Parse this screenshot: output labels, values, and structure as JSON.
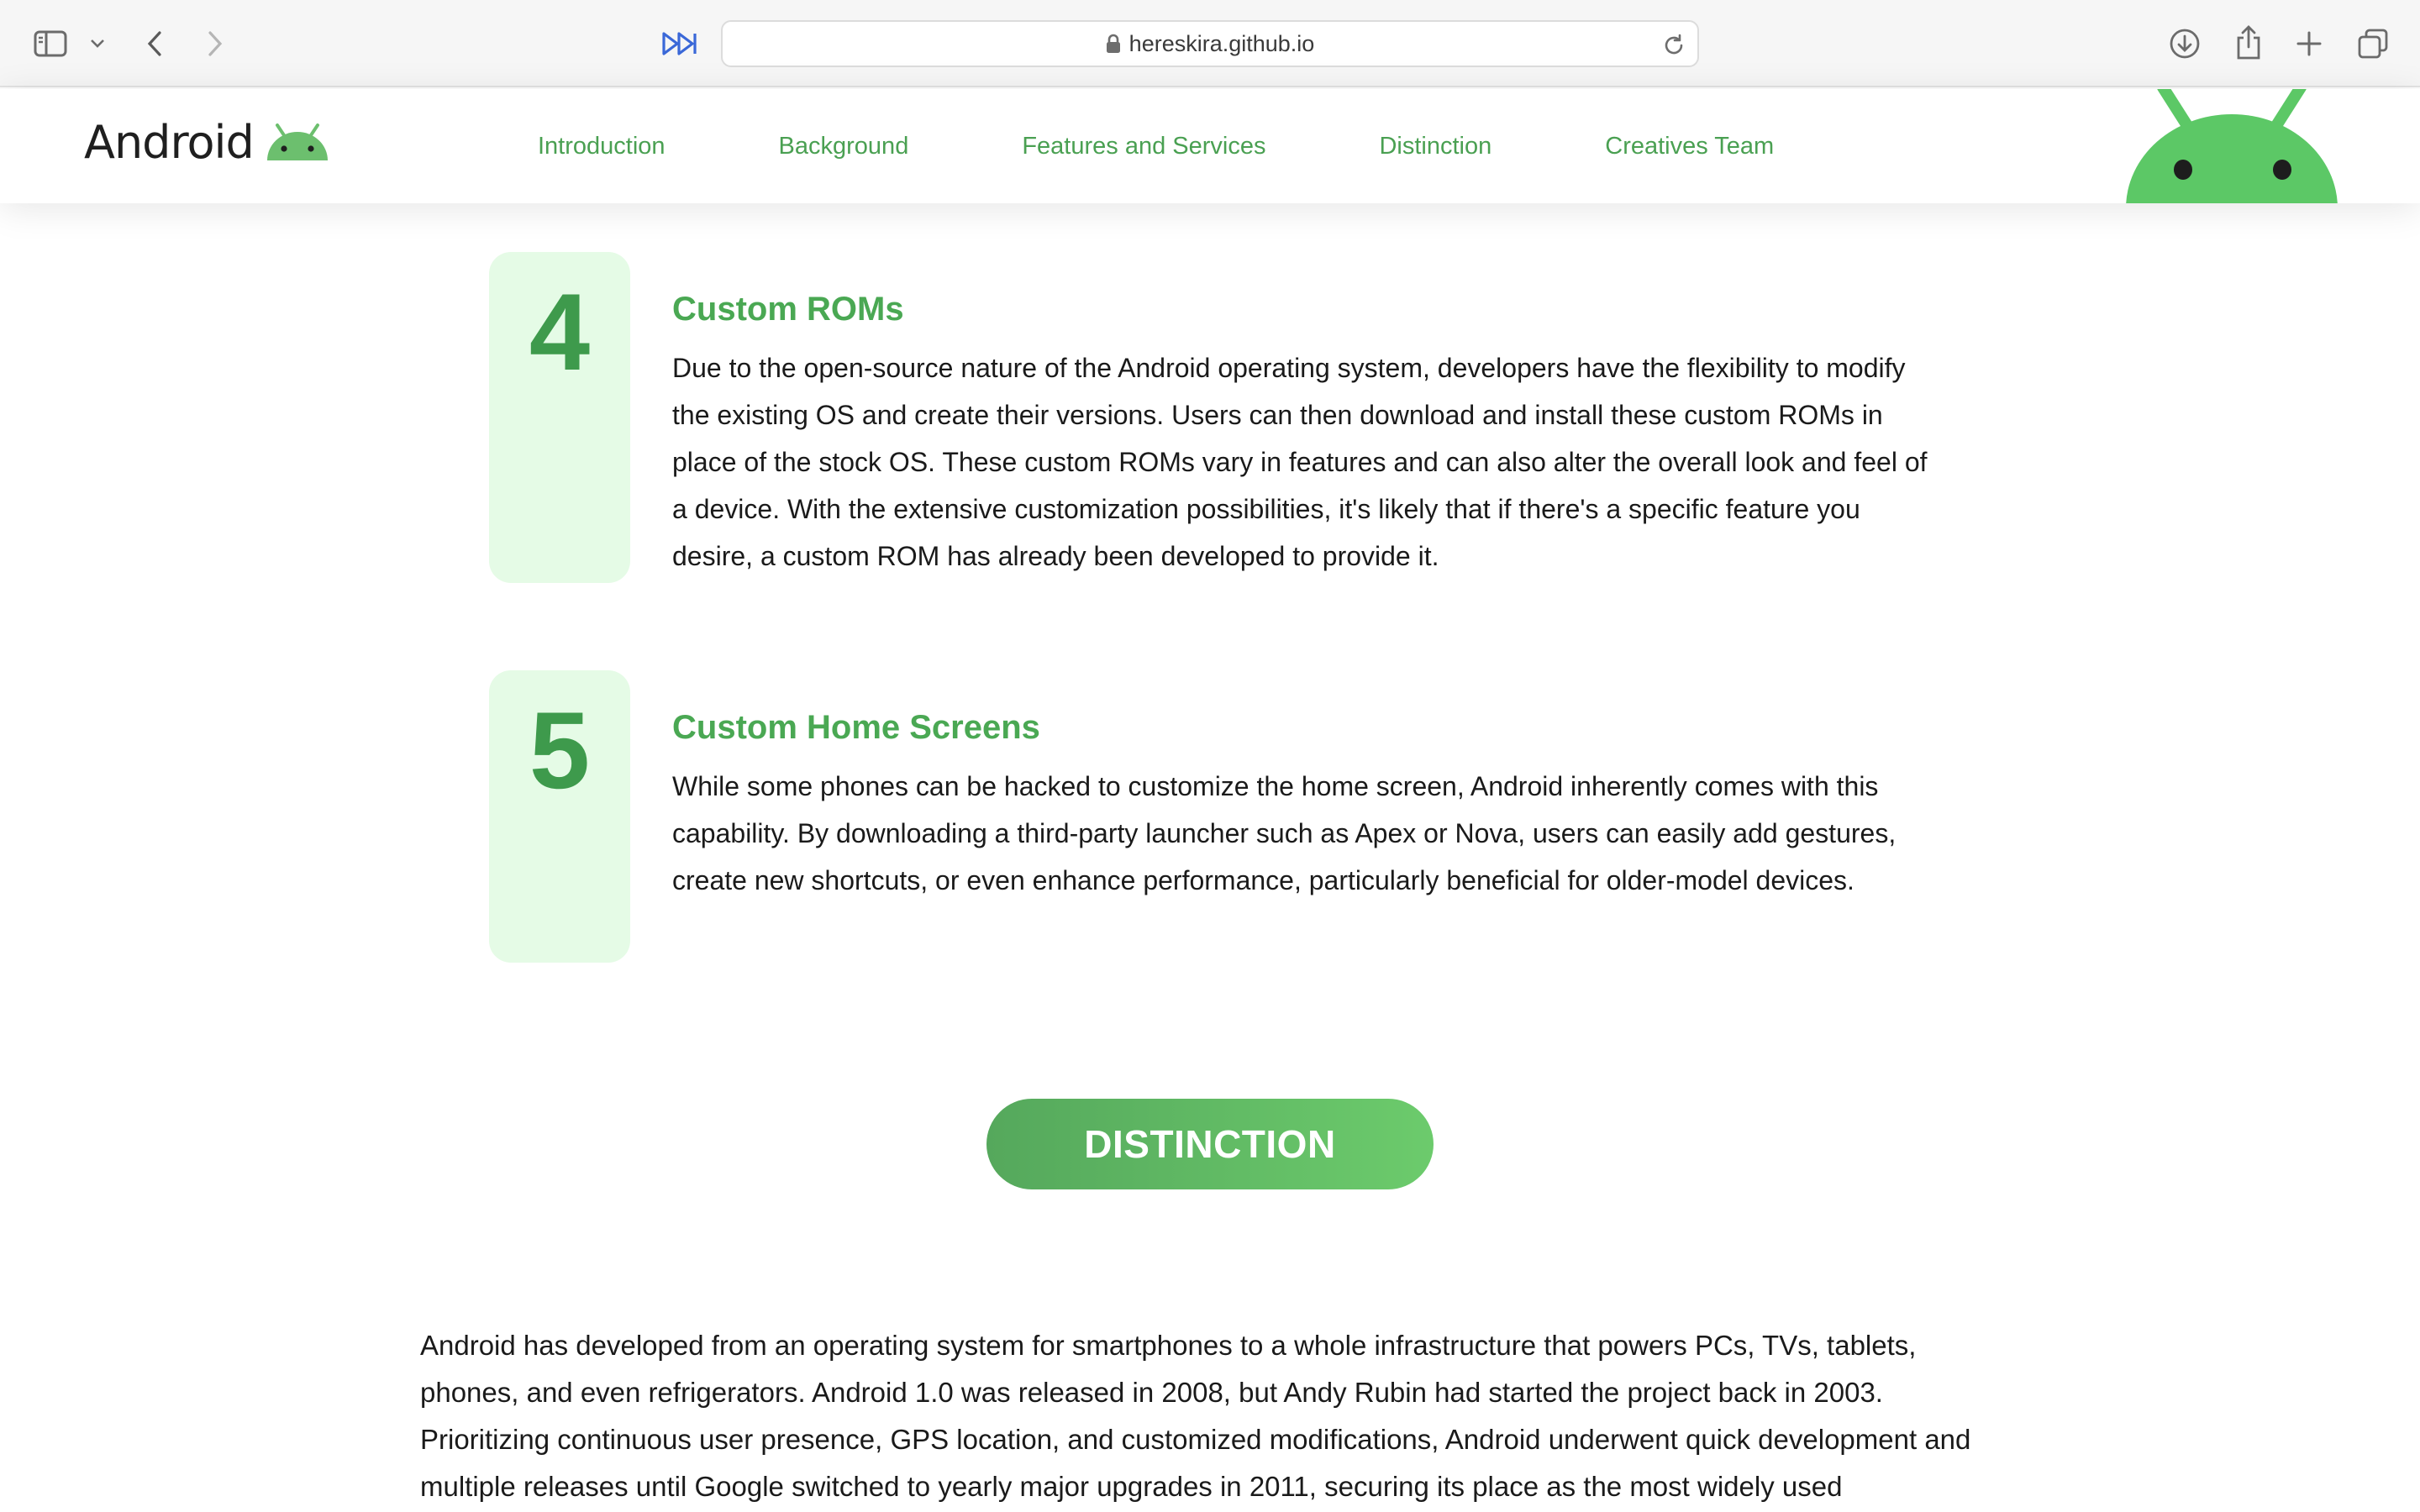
{
  "browser": {
    "url": "hereskira.github.io"
  },
  "site": {
    "logo_text": "Android",
    "nav": [
      "Introduction",
      "Background",
      "Features and Services",
      "Distinction",
      "Creatives Team"
    ],
    "accent_color": "#4aa052",
    "mascot_color": "#5cc866"
  },
  "features": [
    {
      "number": "4",
      "title": "Custom ROMs",
      "body": "Due to the open-source nature of the Android operating system, developers have the flexibility to modify the existing OS and create their versions. Users can then download and install these custom ROMs in place of the stock OS. These custom ROMs vary in features and can also alter the overall look and feel of a device. With the extensive customization possibilities, it's likely that if there's a specific feature you desire, a custom ROM has already been developed to provide it."
    },
    {
      "number": "5",
      "title": "Custom Home Screens",
      "body": "While some phones can be hacked to customize the home screen, Android inherently comes with this capability. By downloading a third-party launcher such as Apex or Nova, users can easily add gestures, create new shortcuts, or even enhance performance, particularly beneficial for older-model devices."
    }
  ],
  "distinction": {
    "heading": "DISTINCTION",
    "paragraph": "Android has developed from an operating system for smartphones to a whole infrastructure that powers PCs, TVs, tablets, phones, and even refrigerators. Android 1.0 was released in 2008, but Andy Rubin had started the project back in 2003. Prioritizing continuous user presence, GPS location, and customized modifications, Android underwent quick development and multiple releases until Google switched to yearly major upgrades in 2011, securing its place as the most widely used"
  }
}
